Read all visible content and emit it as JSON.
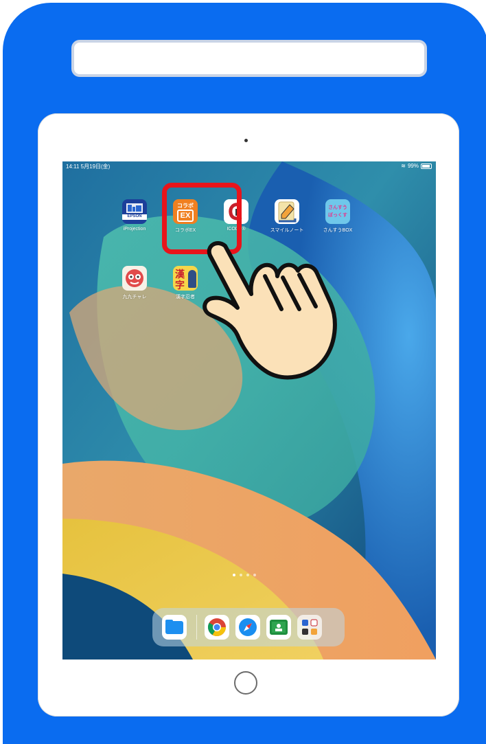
{
  "status_bar": {
    "time": "14:11",
    "date": "5月19日(金)",
    "battery": "99%"
  },
  "apps": [
    {
      "label": "iProjection",
      "icon": "epson-iprojection-icon",
      "badge": "EPSON"
    },
    {
      "label": "コラボEX",
      "icon": "collabo-ex-icon",
      "text_top": "コラボ",
      "text_bottom": "EX"
    },
    {
      "label": "ICODE®",
      "icon": "icode-icon"
    },
    {
      "label": "スマイルノート",
      "icon": "smile-note-icon"
    },
    {
      "label": "さんすうBOX",
      "icon": "sansu-box-icon",
      "text_top": "さんすう",
      "text_bottom": "ぼっくす"
    },
    {
      "label": "九九チャレ",
      "icon": "kuku-challe-icon"
    },
    {
      "label": "漢字忍者",
      "icon": "kanji-ninja-icon",
      "text_top": "漢",
      "text_bottom": "字"
    }
  ],
  "page_dots": 4,
  "dock": [
    "files-icon",
    "chrome-icon",
    "safari-icon",
    "classroom-icon",
    "app-folder-icon"
  ],
  "colors": {
    "frame": "#0a6cf0",
    "highlight": "#e8141b",
    "collabo": "#f08020"
  }
}
